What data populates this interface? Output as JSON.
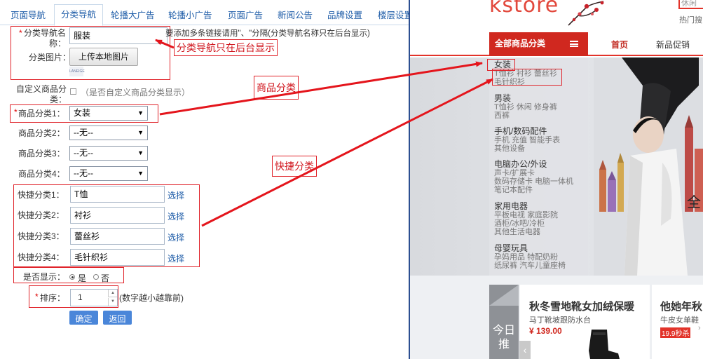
{
  "tabs": [
    "页面导航",
    "分类导航",
    "轮播大广告",
    "轮播小广告",
    "页面广告",
    "新闻公告",
    "品牌设置",
    "楼层设置"
  ],
  "active_tab_index": 1,
  "form": {
    "nav_name_label": "分类导航名称：",
    "nav_name_value": "服装",
    "nav_name_hint": "要添加多条链接请用\"、\"分隔(分类导航名称只在后台显示)",
    "image_label": "分类图片：",
    "upload_button": "上传本地图片",
    "thumb_text": "LANEIGE",
    "custom_label": "自定义商品分类：",
    "custom_hint": "（是否自定义商品分类显示）",
    "category1_label": "商品分类1：",
    "category1_value": "女装",
    "category2_label": "商品分类2：",
    "category2_value": "--无--",
    "category3_label": "商品分类3：",
    "category3_value": "--无--",
    "category4_label": "商品分类4：",
    "category4_value": "--无--",
    "quick1_label": "快捷分类1：",
    "quick1_value": "T恤",
    "quick2_label": "快捷分类2：",
    "quick2_value": "衬衫",
    "quick3_label": "快捷分类3：",
    "quick3_value": "蕾丝衫",
    "quick4_label": "快捷分类4：",
    "quick4_value": "毛针织衫",
    "choose_link": "选择",
    "display_label": "是否显示：",
    "display_yes": "是",
    "display_no": "否",
    "display_selected": "是",
    "sort_label": "排序：",
    "sort_value": "1",
    "sort_hint": "(数字越小越靠前)",
    "confirm_button": "确定",
    "back_button": "返回"
  },
  "annotations": {
    "nav_name_note": "分类导航只在后台显示",
    "product_category_note": "商品分类",
    "quick_category_note": "快捷分类"
  },
  "store": {
    "logo": "kstore",
    "search_placeholder": "休闲",
    "hot_search": "热门搜",
    "all_categories": "全部商品分类",
    "nav_items": [
      "首页",
      "新品促销"
    ],
    "categories": [
      {
        "title": "女装",
        "subs": [
          "T恤衫",
          "衬衫",
          "蕾丝衫",
          "毛针织衫"
        ]
      },
      {
        "title": "男装",
        "subs": [
          "T恤衫",
          "休闲",
          "修身裤",
          "西裤"
        ]
      },
      {
        "title": "手机/数码配件",
        "subs": [
          "手机",
          "充值",
          "智能手表",
          "其他设备"
        ]
      },
      {
        "title": "电脑办公/外设",
        "subs": [
          "声卡/扩展卡",
          "数码存储卡",
          "电脑一体机",
          "笔记本配件"
        ]
      },
      {
        "title": "家用电器",
        "subs": [
          "平板电视",
          "家庭影院",
          "酒柜/冰吧/冷柜",
          "其他生活电器"
        ]
      },
      {
        "title": "母婴玩具",
        "subs": [
          "孕妈用品",
          "特配奶粉",
          "纸尿裤",
          "汽车儿童座椅"
        ]
      }
    ],
    "banner_text": "全",
    "today_label": "今日推",
    "product1": {
      "title": "秋冬雪地靴女加绒保暖",
      "sub": "马丁靴坡跟防水台",
      "price": "¥ 139.00"
    },
    "product2": {
      "title": "他她年秋",
      "sub": "牛皮女单鞋",
      "price_tag": "19.9秒杀"
    },
    "colors": {
      "brand_red": "#d0281f",
      "link_blue": "#1f5da8",
      "annotation_red": "#e0232a"
    }
  }
}
